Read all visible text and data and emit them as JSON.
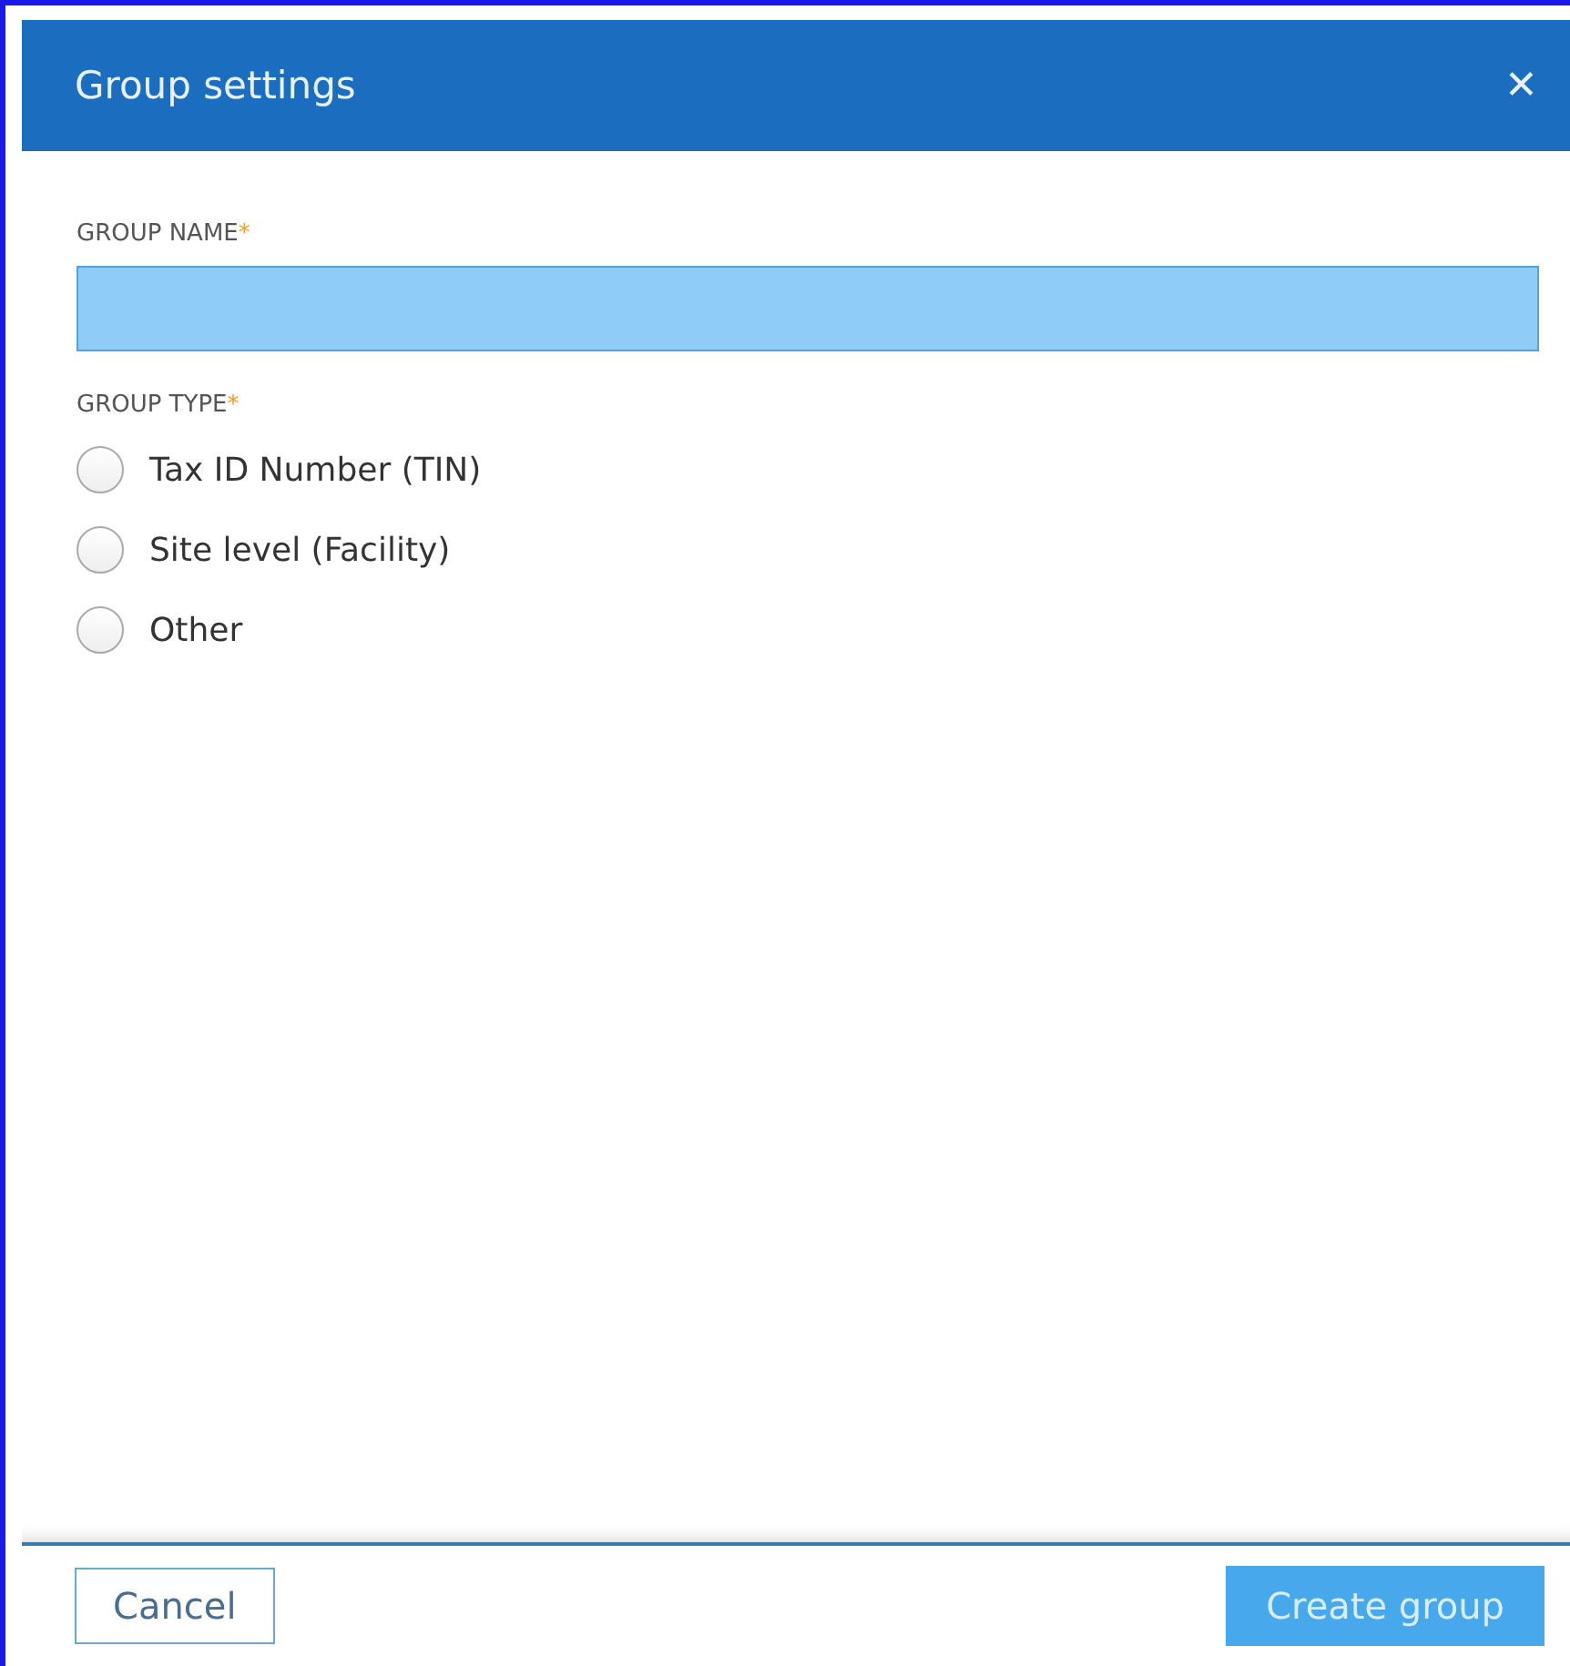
{
  "dialog": {
    "title": "Group settings",
    "close": "✕"
  },
  "name_field": {
    "label": "GROUP NAME",
    "required_mark": "*",
    "focused": true
  },
  "type_group": {
    "label": "GROUP TYPE",
    "required_mark": "*",
    "options": [
      {
        "label": "Tax ID Number (TIN)",
        "selected": false
      },
      {
        "label": "Site level (Facility)",
        "selected": false
      },
      {
        "label": "Other",
        "selected": false
      }
    ]
  },
  "buttons": {
    "cancel": "Cancel",
    "create": "Create group",
    "create_disabled": true
  }
}
